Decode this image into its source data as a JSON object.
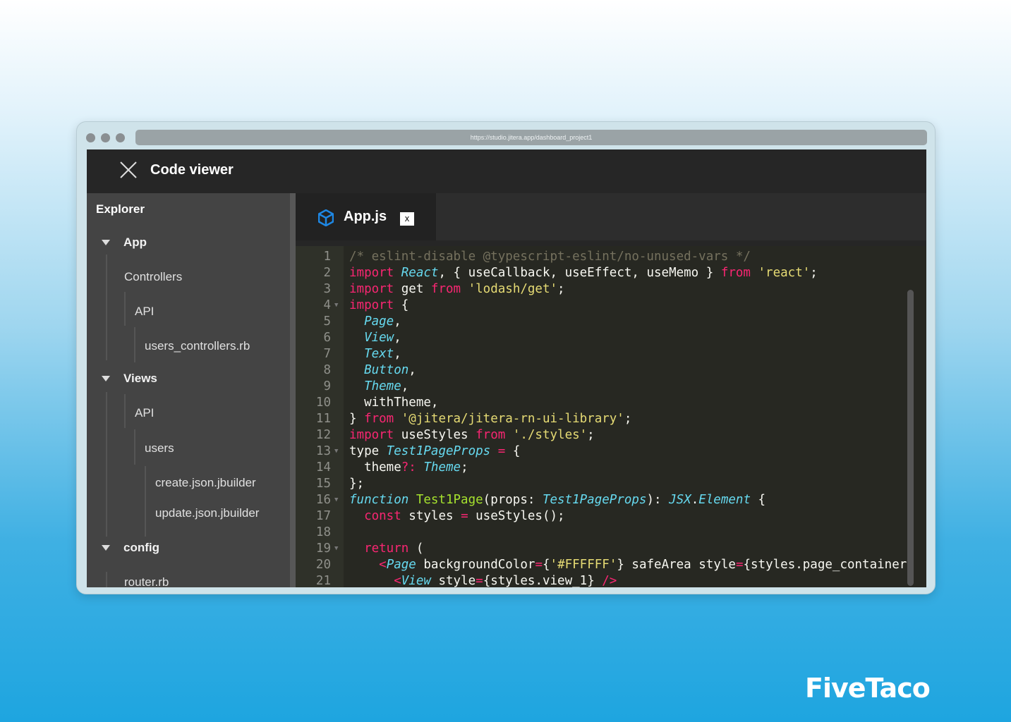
{
  "browser": {
    "url": "https://studio.jitera.app/dashboard_project1"
  },
  "header": {
    "title": "Code viewer"
  },
  "sidebar": {
    "title": "Explorer",
    "items": [
      {
        "label": "App",
        "type": "folder"
      },
      {
        "label": "Controllers",
        "type": "folder"
      },
      {
        "label": "API",
        "type": "folder"
      },
      {
        "label": "users_controllers.rb",
        "type": "file"
      },
      {
        "label": "Views",
        "type": "folder"
      },
      {
        "label": "API",
        "type": "folder"
      },
      {
        "label": "users",
        "type": "folder"
      },
      {
        "label": "create.json.jbuilder",
        "type": "file"
      },
      {
        "label": "update.json.jbuilder",
        "type": "file"
      },
      {
        "label": "config",
        "type": "folder"
      },
      {
        "label": "router.rb",
        "type": "file"
      }
    ]
  },
  "tab": {
    "label": "App.js",
    "close": "x",
    "icon": "cube-icon",
    "icon_color": "#1e88e5"
  },
  "code": [
    {
      "n": "1",
      "t": [
        [
          "cm",
          "/* eslint-disable @typescript-eslint/no-unused-vars */"
        ]
      ]
    },
    {
      "n": "2",
      "t": [
        [
          "kw",
          "import "
        ],
        [
          "it",
          "React"
        ],
        [
          "pl",
          ", { useCallback, useEffect, useMemo } "
        ],
        [
          "kw",
          "from "
        ],
        [
          "str",
          "'react'"
        ],
        [
          "pl",
          ";"
        ]
      ]
    },
    {
      "n": "3",
      "t": [
        [
          "kw",
          "import "
        ],
        [
          "pl",
          "get "
        ],
        [
          "kw",
          "from "
        ],
        [
          "str",
          "'lodash/get'"
        ],
        [
          "pl",
          ";"
        ]
      ]
    },
    {
      "n": "4",
      "f": true,
      "t": [
        [
          "kw",
          "import "
        ],
        [
          "pl",
          "{"
        ]
      ]
    },
    {
      "n": "5",
      "t": [
        [
          "pl",
          "  "
        ],
        [
          "it",
          "Page"
        ],
        [
          "pl",
          ","
        ]
      ]
    },
    {
      "n": "6",
      "t": [
        [
          "pl",
          "  "
        ],
        [
          "it",
          "View"
        ],
        [
          "pl",
          ","
        ]
      ]
    },
    {
      "n": "7",
      "t": [
        [
          "pl",
          "  "
        ],
        [
          "it",
          "Text"
        ],
        [
          "pl",
          ","
        ]
      ]
    },
    {
      "n": "8",
      "t": [
        [
          "pl",
          "  "
        ],
        [
          "it",
          "Button"
        ],
        [
          "pl",
          ","
        ]
      ]
    },
    {
      "n": "9",
      "t": [
        [
          "pl",
          "  "
        ],
        [
          "it",
          "Theme"
        ],
        [
          "pl",
          ","
        ]
      ]
    },
    {
      "n": "10",
      "t": [
        [
          "pl",
          "  withTheme,"
        ]
      ]
    },
    {
      "n": "11",
      "t": [
        [
          "pl",
          "} "
        ],
        [
          "kw",
          "from "
        ],
        [
          "str",
          "'@jitera/jitera-rn-ui-library'"
        ],
        [
          "pl",
          ";"
        ]
      ]
    },
    {
      "n": "12",
      "t": [
        [
          "kw",
          "import "
        ],
        [
          "pl",
          "useStyles "
        ],
        [
          "kw",
          "from "
        ],
        [
          "str",
          "'./styles'"
        ],
        [
          "pl",
          ";"
        ]
      ]
    },
    {
      "n": "13",
      "f": true,
      "t": [
        [
          "pl",
          "type "
        ],
        [
          "it",
          "Test1PageProps"
        ],
        [
          "kw",
          " = "
        ],
        [
          "pl",
          "{"
        ]
      ]
    },
    {
      "n": "14",
      "t": [
        [
          "pl",
          "  theme"
        ],
        [
          "kw",
          "?: "
        ],
        [
          "it",
          "Theme"
        ],
        [
          "pl",
          ";"
        ]
      ]
    },
    {
      "n": "15",
      "t": [
        [
          "pl",
          "};"
        ]
      ]
    },
    {
      "n": "16",
      "f": true,
      "t": [
        [
          "it",
          "function "
        ],
        [
          "fn",
          "Test1Page"
        ],
        [
          "pl",
          "(props: "
        ],
        [
          "it",
          "Test1PageProps"
        ],
        [
          "pl",
          "): "
        ],
        [
          "it",
          "JSX"
        ],
        [
          "pl",
          "."
        ],
        [
          "it",
          "Element"
        ],
        [
          "pl",
          " {"
        ]
      ]
    },
    {
      "n": "17",
      "t": [
        [
          "pl",
          "  "
        ],
        [
          "kw",
          "const "
        ],
        [
          "pl",
          "styles "
        ],
        [
          "kw",
          "= "
        ],
        [
          "pl",
          "useStyles();"
        ]
      ]
    },
    {
      "n": "18",
      "t": [
        [
          "pl",
          ""
        ]
      ]
    },
    {
      "n": "19",
      "f": true,
      "t": [
        [
          "pl",
          "  "
        ],
        [
          "kw",
          "return "
        ],
        [
          "pl",
          "("
        ]
      ]
    },
    {
      "n": "20",
      "t": [
        [
          "pl",
          "    "
        ],
        [
          "kw",
          "<"
        ],
        [
          "it",
          "Page"
        ],
        [
          "pl",
          " backgroundColor"
        ],
        [
          "kw",
          "="
        ],
        [
          "pl",
          "{"
        ],
        [
          "str",
          "'#FFFFFF'"
        ],
        [
          "pl",
          "} safeArea style"
        ],
        [
          "kw",
          "="
        ],
        [
          "pl",
          "{styles.page_container}"
        ]
      ]
    },
    {
      "n": "21",
      "t": [
        [
          "pl",
          "      "
        ],
        [
          "kw",
          "<"
        ],
        [
          "it",
          "View"
        ],
        [
          "pl",
          " style"
        ],
        [
          "kw",
          "="
        ],
        [
          "pl",
          "{styles.view_1} "
        ],
        [
          "kw",
          "/>"
        ]
      ]
    }
  ],
  "brand": {
    "logo": "FiveTaco"
  }
}
